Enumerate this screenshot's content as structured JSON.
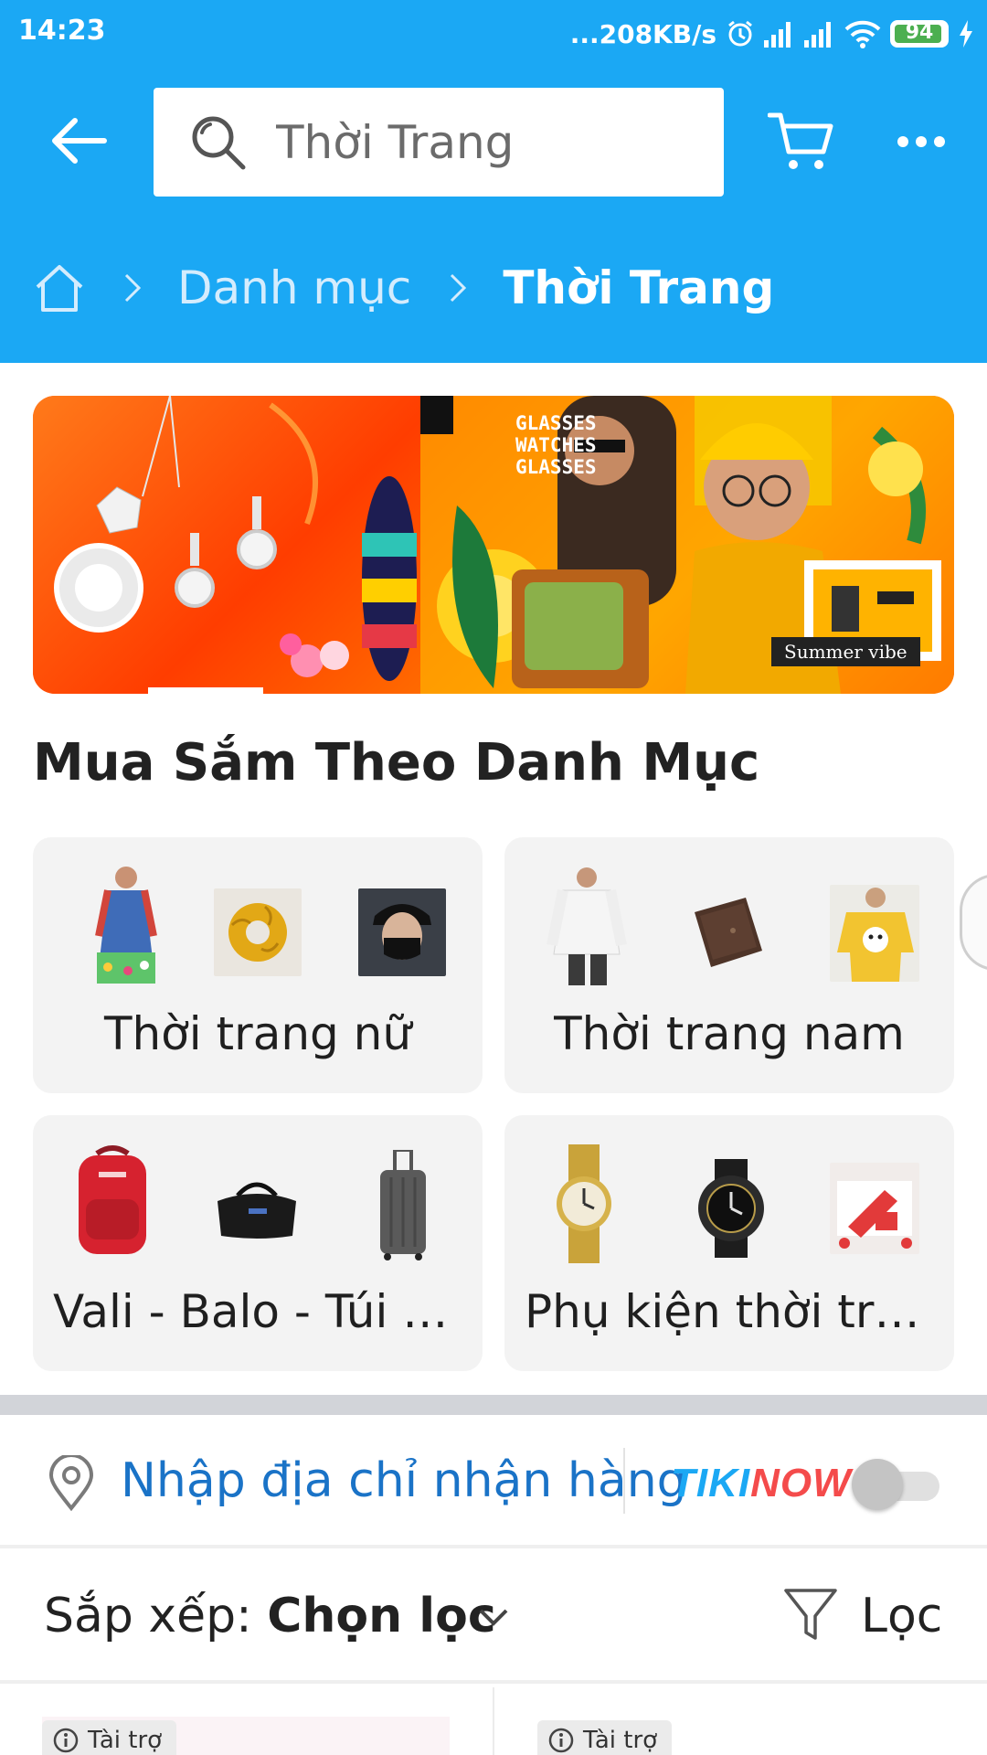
{
  "status_bar": {
    "time": "14:23",
    "network_speed": "...208KB/s",
    "battery": "94",
    "battery_level": 0.94
  },
  "header": {
    "search_placeholder": "Thời Trang",
    "icons": [
      "back-arrow-icon",
      "search-icon",
      "cart-icon",
      "more-icon"
    ],
    "color": "#1ba8f4"
  },
  "breadcrumb": {
    "items": [
      {
        "label": "Danh mục"
      },
      {
        "label": "Thời Trang"
      }
    ]
  },
  "banner": {
    "text_lines": "GLASSES\nWATCHES\nGLASSES",
    "tag": "Summer vibe"
  },
  "section": {
    "title": "Mua Sắm Theo Danh Mục"
  },
  "categories": [
    {
      "label": "Thời trang nữ"
    },
    {
      "label": "Thời trang nam"
    },
    {
      "label": "Vali - Balo - Túi xách"
    },
    {
      "label": "Phụ kiện thời trang"
    }
  ],
  "location": {
    "text": "Nhập địa chỉ nhận hàng",
    "tikinow_tiki": "TIKI",
    "tikinow_now": "NOW"
  },
  "sort": {
    "label": "Sắp xếp: ",
    "value": "Chọn lọc",
    "filter_label": "Lọc"
  },
  "products": [
    {
      "sponsor": "Tài trợ"
    },
    {
      "sponsor": "Tài trợ"
    }
  ]
}
